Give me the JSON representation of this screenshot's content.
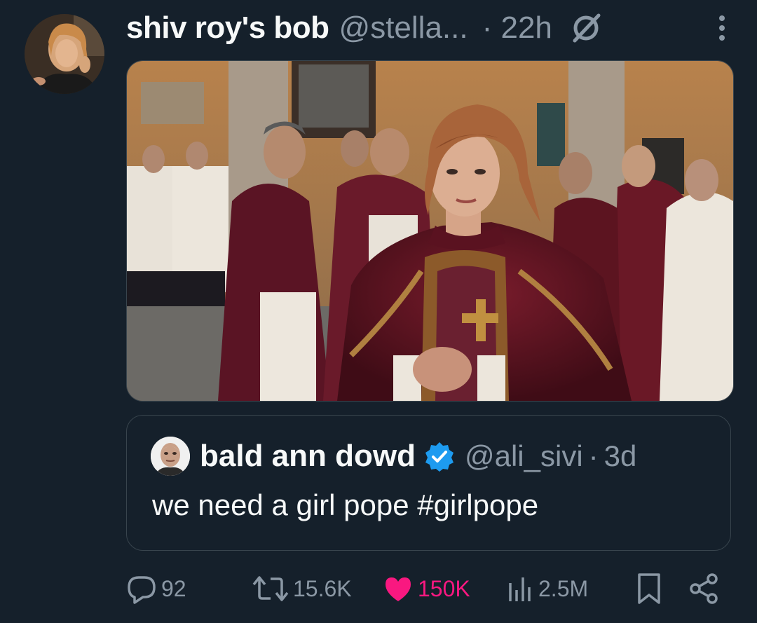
{
  "author": {
    "display_name": "shiv roy's bob",
    "handle": "@stella...",
    "time": "· 22h",
    "avatar_icon": "profile-photo",
    "grok_icon": "grok-icon",
    "more_icon": "more-vertical-icon"
  },
  "media": {
    "description_icon": "photo"
  },
  "quoted_tweet": {
    "display_name": "bald ann dowd",
    "verified": true,
    "handle": "@ali_sivi",
    "separator": "·",
    "time": "3d",
    "text": "we need a girl pope #girlpope"
  },
  "actions": {
    "replies": "92",
    "reposts": "15.6K",
    "likes": "150K",
    "views": "2.5M",
    "icons": [
      "reply-icon",
      "repost-icon",
      "like-icon",
      "views-icon",
      "bookmark-icon",
      "share-icon"
    ]
  },
  "colors": {
    "background": "#15202b",
    "text": "#f7f9f9",
    "muted": "#8b98a5",
    "like": "#f91880",
    "verified": "#1d9bf0",
    "border": "#38444d"
  }
}
